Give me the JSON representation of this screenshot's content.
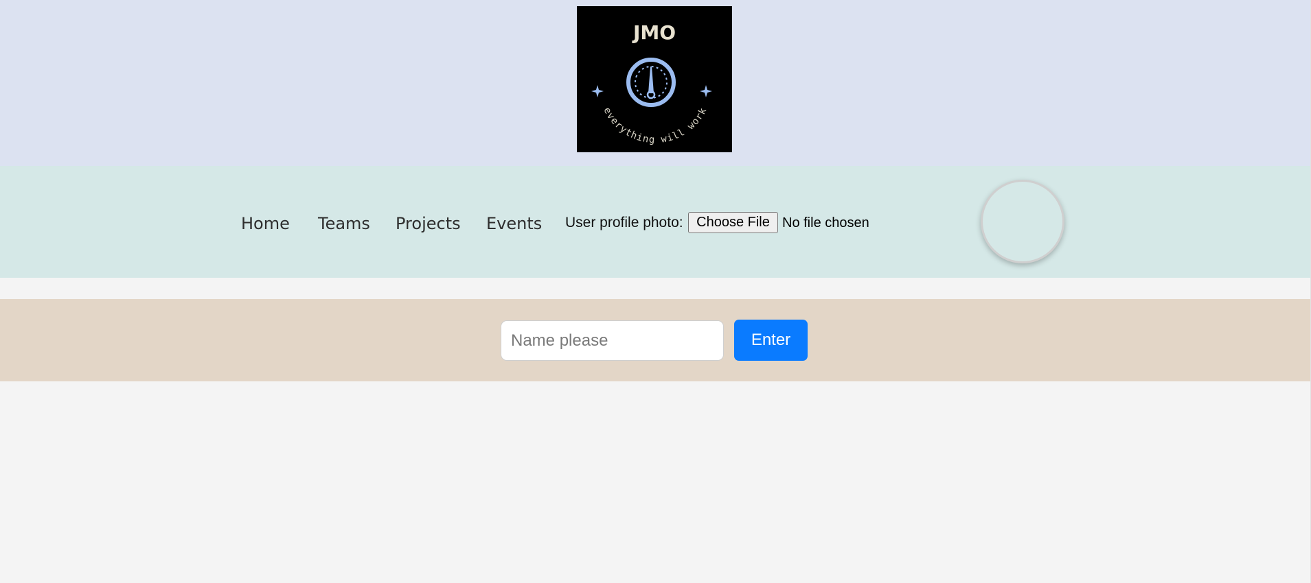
{
  "logo": {
    "name": "JMO",
    "tagline": "everything will work",
    "icon": "gauge-icon",
    "colors": {
      "background": "#000000",
      "accent": "#9bbcf0",
      "text": "#e8e2d0"
    }
  },
  "nav": {
    "items": [
      {
        "label": "Home"
      },
      {
        "label": "Teams"
      },
      {
        "label": "Projects"
      },
      {
        "label": "Events"
      }
    ]
  },
  "profile": {
    "label": "User profile photo:",
    "button_label": "Choose File",
    "status": "No file chosen"
  },
  "name_form": {
    "placeholder": "Name please",
    "value": "",
    "button_label": "Enter"
  },
  "colors": {
    "header_bg": "#dce2f1",
    "nav_bg": "#d5e8e7",
    "form_bg": "#e3d6c7",
    "page_bg": "#f4f4f4",
    "primary_button": "#0a7bff"
  }
}
